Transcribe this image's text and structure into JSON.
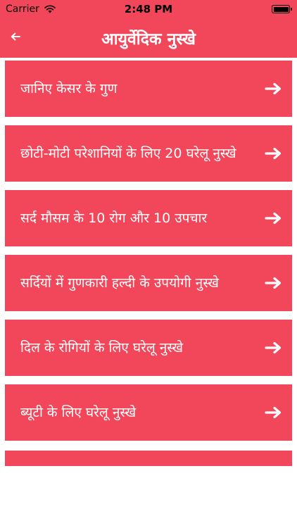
{
  "status_bar": {
    "carrier": "Carrier",
    "time": "2:48 PM",
    "icons": [
      "wifi-icon",
      "battery-icon"
    ]
  },
  "header": {
    "title": "आयुर्वेदिक नुस्खे",
    "back_icon": "back-arrow-icon"
  },
  "colors": {
    "accent": "#f2465a",
    "text_on_accent": "#ffffff",
    "background": "#ffffff"
  },
  "list": {
    "items": [
      {
        "label": "जानिए केसर के गुण"
      },
      {
        "label": "छोटी-मोटी परेशानियों के लिए 20 घरेलू नुस्खे"
      },
      {
        "label": "सर्द मौसम के 10 रोग और 10 उपचार"
      },
      {
        "label": "सर्दियों में गुणकारी हल्दी के उपयोगी नुस्खे"
      },
      {
        "label": "दिल के रोगियों के लिए घरेलू नुस्खे"
      },
      {
        "label": "ब्यूटी के लिए घरेलू नुस्खे"
      }
    ],
    "item_icon": "arrow-right-icon"
  }
}
